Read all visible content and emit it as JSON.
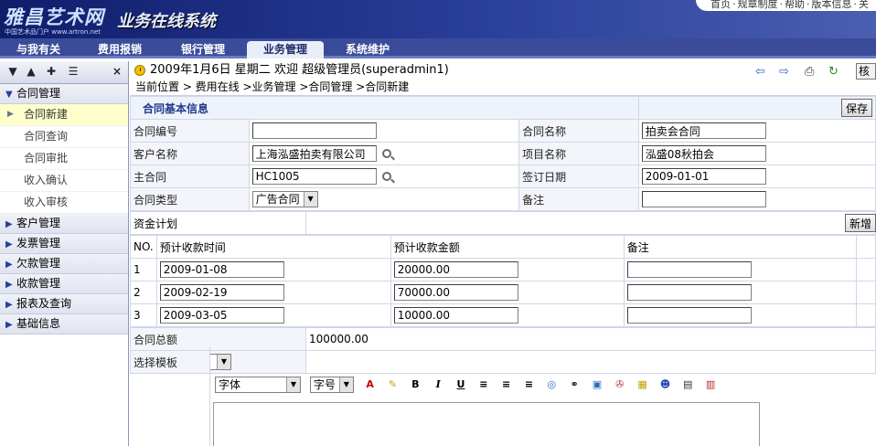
{
  "banner": {
    "logo_text": "雅昌艺术网",
    "logo_sub": "中国艺术品门户 www.artron.net",
    "system_title": "业务在线系统",
    "top_links": [
      "首页",
      "规章制度",
      "帮助",
      "版本信息",
      "关"
    ]
  },
  "nav": {
    "tabs": [
      {
        "label": "与我有关"
      },
      {
        "label": "费用报销"
      },
      {
        "label": "银行管理"
      },
      {
        "label": "业务管理",
        "active": true
      },
      {
        "label": "系统维护"
      }
    ]
  },
  "sidebar": {
    "close_icon": "×",
    "groups": [
      {
        "label": "合同管理",
        "expanded": true,
        "items": [
          "合同新建",
          "合同查询",
          "合同审批",
          "收入确认",
          "收入审核"
        ],
        "active_item": "合同新建"
      },
      {
        "label": "客户管理"
      },
      {
        "label": "发票管理"
      },
      {
        "label": "欠款管理"
      },
      {
        "label": "收款管理"
      },
      {
        "label": "报表及查询"
      },
      {
        "label": "基础信息"
      }
    ]
  },
  "info": {
    "date": "2009年1月6日",
    "weekday": "星期二",
    "welcome": "欢迎",
    "user": "超级管理员(superadmin1)",
    "audit_label": "核"
  },
  "breadcrumb": {
    "text": "当前位置 > 费用在线 >业务管理 >合同管理 >合同新建"
  },
  "form": {
    "section_title": "合同基本信息",
    "save_label": "保存",
    "contract_no": {
      "label": "合同编号",
      "value": ""
    },
    "contract_name": {
      "label": "合同名称",
      "value": "拍卖会合同"
    },
    "customer": {
      "label": "客户名称",
      "value": "上海泓盛拍卖有限公司"
    },
    "project": {
      "label": "项目名称",
      "value": "泓盛08秋拍会"
    },
    "main_contract": {
      "label": "主合同",
      "value": "HC1005"
    },
    "sign_date": {
      "label": "签订日期",
      "value": "2009-01-01"
    },
    "contract_type": {
      "label": "合同类型",
      "value": "广告合同"
    },
    "remark": {
      "label": "备注",
      "value": ""
    }
  },
  "fund_plan": {
    "title": "资金计划",
    "add_label": "新增",
    "headers": [
      "NO.",
      "预计收款时间",
      "预计收款金额",
      "备注"
    ],
    "rows": [
      {
        "no": "1",
        "date": "2009-01-08",
        "amount": "20000.00",
        "note": ""
      },
      {
        "no": "2",
        "date": "2009-02-19",
        "amount": "70000.00",
        "note": ""
      },
      {
        "no": "3",
        "date": "2009-03-05",
        "amount": "10000.00",
        "note": ""
      }
    ]
  },
  "total": {
    "label": "合同总额",
    "value": "100000.00"
  },
  "template": {
    "label": "选择模板",
    "value": ""
  },
  "editor": {
    "font_label": "字体",
    "size_label": "字号"
  }
}
